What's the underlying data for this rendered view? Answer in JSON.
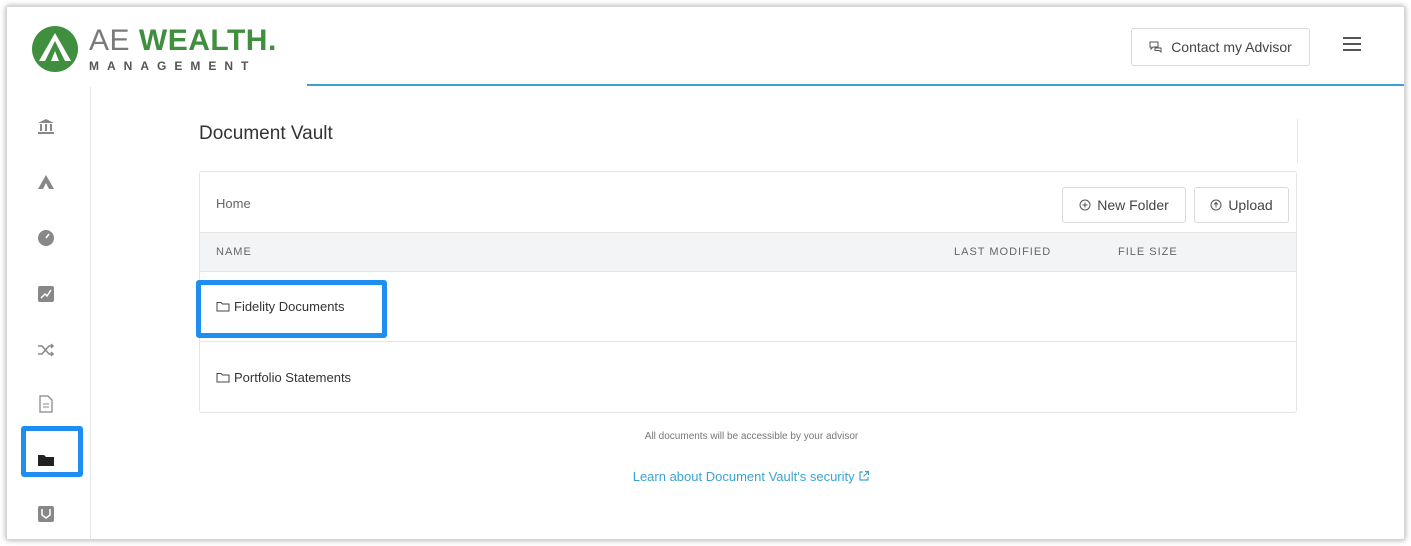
{
  "brand": {
    "line1_a": "AE",
    "line1_b": "WEALTH",
    "line1_dot": ".",
    "line2": "MANAGEMENT",
    "colors": {
      "green": "#3f8f3f",
      "grey": "#7a7a7a",
      "accent": "#3aa3d4",
      "highlight": "#1e8ff0"
    }
  },
  "header": {
    "contact_label": "Contact my Advisor",
    "contact_icon": "chat-bubbles-icon",
    "menu_icon": "hamburger-menu-icon"
  },
  "sidebar": {
    "items": [
      {
        "icon": "bank-icon",
        "active": false
      },
      {
        "icon": "pyramid-icon",
        "active": false
      },
      {
        "icon": "gauge-icon",
        "active": false
      },
      {
        "icon": "chart-trend-icon",
        "active": false
      },
      {
        "icon": "shuffle-icon",
        "active": false
      },
      {
        "icon": "document-icon",
        "active": false
      },
      {
        "icon": "folder-icon",
        "active": true
      },
      {
        "icon": "badge-icon",
        "active": false
      }
    ]
  },
  "main": {
    "title": "Document Vault",
    "breadcrumb": "Home",
    "new_folder_label": "New Folder",
    "upload_label": "Upload",
    "columns": [
      "NAME",
      "LAST MODIFIED",
      "FILE SIZE"
    ],
    "rows": [
      {
        "name": "Fidelity Documents",
        "modified": "",
        "size": ""
      },
      {
        "name": "Portfolio Statements",
        "modified": "",
        "size": ""
      }
    ],
    "note": "All documents will be accessible by your advisor",
    "security_link": "Learn about Document Vault's security"
  }
}
